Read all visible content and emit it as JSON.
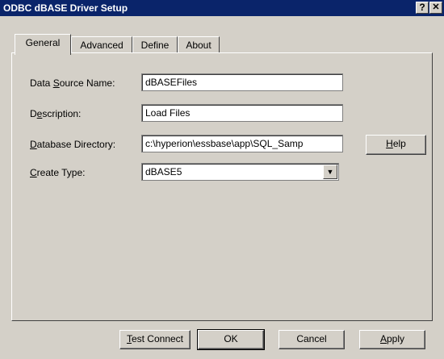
{
  "window": {
    "title": "ODBC dBASE Driver Setup",
    "help_glyph": "?",
    "close_glyph": "✕"
  },
  "tabs": [
    {
      "label": "General"
    },
    {
      "label": "Advanced"
    },
    {
      "label": "Define"
    },
    {
      "label": "About"
    }
  ],
  "form": {
    "dsn_label": {
      "pre": "Data ",
      "key": "S",
      "post": "ource Name:"
    },
    "dsn_value": "dBASEFiles",
    "desc_label": {
      "pre": "D",
      "key": "e",
      "post": "scription:"
    },
    "desc_value": "Load Files",
    "dir_label": {
      "pre": "",
      "key": "D",
      "post": "atabase Directory:"
    },
    "dir_value": "c:\\hyperion\\essbase\\app\\SQL_Samp",
    "type_label": {
      "pre": "",
      "key": "C",
      "post": "reate Type:"
    },
    "type_value": "dBASE5",
    "help_button": {
      "pre": "",
      "key": "H",
      "post": "elp"
    }
  },
  "buttons": {
    "test_connect": {
      "pre": "",
      "key": "T",
      "post": "est Connect"
    },
    "ok": "OK",
    "cancel": "Cancel",
    "apply": {
      "pre": "",
      "key": "A",
      "post": "pply"
    }
  }
}
